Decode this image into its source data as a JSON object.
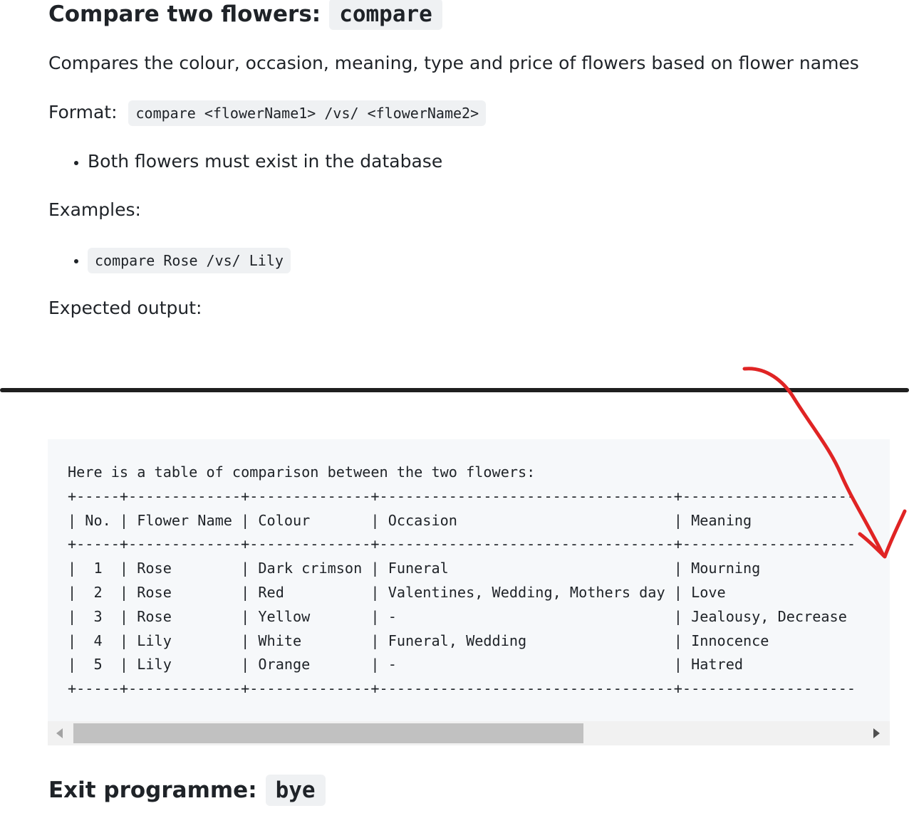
{
  "compare_section": {
    "heading": "Compare two flowers:",
    "command": "compare",
    "description": "Compares the colour, occasion, meaning, type and price of flowers based on flower names",
    "format_label": "Format:",
    "format_code": "compare <flowerName1> /vs/ <flowerName2>",
    "bullets": [
      "Both flowers must exist in the database"
    ],
    "examples_label": "Examples:",
    "examples": [
      "compare Rose /vs/ Lily"
    ],
    "expected_label": "Expected output:"
  },
  "output": {
    "intro": "Here is a table of comparison between the two flowers:",
    "separator": "+-----+-------------+--------------+----------------------------------+--------------------",
    "header_row": "| No. | Flower Name | Colour       | Occasion                         | Meaning",
    "rows": [
      "|  1  | Rose        | Dark crimson | Funeral                          | Mourning",
      "|  2  | Rose        | Red          | Valentines, Wedding, Mothers day | Love",
      "|  3  | Rose        | Yellow       | -                                | Jealousy, Decrease",
      "|  4  | Lily        | White        | Funeral, Wedding                 | Innocence",
      "|  5  | Lily        | Orange       | -                                | Hatred"
    ]
  },
  "scrollbar": {
    "position": 0
  },
  "exit_section": {
    "heading": "Exit programme:",
    "command": "bye"
  },
  "annotation": {
    "color": "#e02424"
  }
}
